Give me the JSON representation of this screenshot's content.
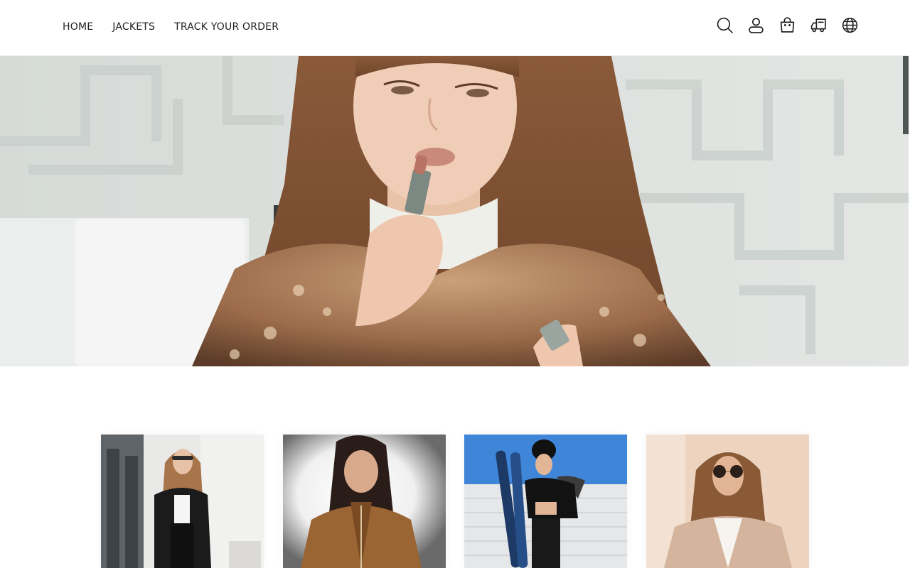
{
  "nav": {
    "items": [
      {
        "label": "HOME"
      },
      {
        "label": "JACKETS"
      },
      {
        "label": "TRACK YOUR ORDER"
      }
    ]
  },
  "header_icons": [
    "search-icon",
    "account-icon",
    "cart-icon",
    "shipping-truck-icon",
    "globe-icon"
  ],
  "hero": {
    "image": "woman-applying-lipstick-sequin-jacket"
  },
  "products": [
    {
      "image": "woman-black-jacket-street"
    },
    {
      "image": "woman-brown-leather-jacket"
    },
    {
      "image": "woman-black-puffer-jacket-skis"
    },
    {
      "image": "woman-beige-coat-sunglasses"
    }
  ],
  "colors": {
    "text": "#222222",
    "background": "#ffffff"
  }
}
